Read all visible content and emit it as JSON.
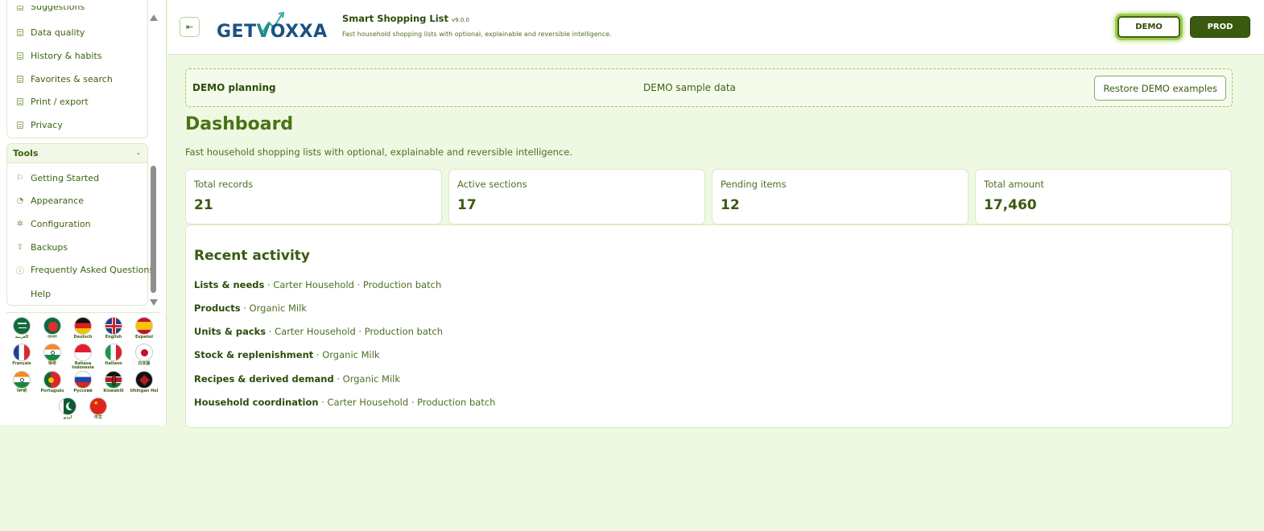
{
  "sidebar": {
    "top_items": [
      {
        "label": "Suggestions",
        "icon": "document-icon"
      },
      {
        "label": "Data quality",
        "icon": "document-icon"
      },
      {
        "label": "History & habits",
        "icon": "document-icon"
      },
      {
        "label": "Favorites & search",
        "icon": "document-icon"
      },
      {
        "label": "Print / export",
        "icon": "document-icon"
      },
      {
        "label": "Privacy",
        "icon": "document-icon"
      }
    ],
    "tools_title": "Tools",
    "tools_collapse": "-",
    "tools_items": [
      {
        "label": "Getting Started",
        "icon": "flag-icon"
      },
      {
        "label": "Appearance",
        "icon": "palette-icon"
      },
      {
        "label": "Configuration",
        "icon": "gear-icon"
      },
      {
        "label": "Backups",
        "icon": "upload-icon"
      },
      {
        "label": "Frequently Asked Questions",
        "icon": "question-icon"
      },
      {
        "label": "Help",
        "icon": ""
      }
    ],
    "languages": [
      {
        "label": "العربية",
        "code": "ar"
      },
      {
        "label": "বাংলা",
        "code": "bn"
      },
      {
        "label": "Deutsch",
        "code": "de"
      },
      {
        "label": "English",
        "code": "en"
      },
      {
        "label": "Español",
        "code": "es"
      },
      {
        "label": "Français",
        "code": "fr"
      },
      {
        "label": "हिन्दी",
        "code": "hi"
      },
      {
        "label": "Bahasa Indonesia",
        "code": "id"
      },
      {
        "label": "Italiano",
        "code": "it"
      },
      {
        "label": "日本語",
        "code": "ja"
      },
      {
        "label": "ਪੰਜਾਬੀ",
        "code": "pa"
      },
      {
        "label": "Português",
        "code": "pt"
      },
      {
        "label": "Русский",
        "code": "ru"
      },
      {
        "label": "Kiswahili",
        "code": "sw"
      },
      {
        "label": "tlhIngan Hol",
        "code": "tlh"
      },
      {
        "label": "اردو",
        "code": "ur"
      },
      {
        "label": "中文",
        "code": "zh"
      }
    ]
  },
  "header": {
    "logo_text_a": "GET",
    "logo_text_b": "V",
    "logo_text_c": "OXXA",
    "app_title": "Smart Shopping List",
    "version": "v9.0.0",
    "subtitle": "Fast household shopping lists with optional, explainable and reversible intelligence.",
    "env_demo": "DEMO",
    "env_prod": "PROD"
  },
  "banner": {
    "title": "DEMO planning",
    "center": "DEMO sample data",
    "restore": "Restore DEMO examples"
  },
  "dashboard": {
    "title": "Dashboard",
    "subtitle": "Fast household shopping lists with optional, explainable and reversible intelligence.",
    "stats": [
      {
        "label": "Total records",
        "value": "21"
      },
      {
        "label": "Active sections",
        "value": "17"
      },
      {
        "label": "Pending items",
        "value": "12"
      },
      {
        "label": "Total amount",
        "value": "17,460"
      }
    ]
  },
  "activity": {
    "title": "Recent activity",
    "rows": [
      {
        "section": "Lists & needs",
        "detail": " · Carter Household · Production batch"
      },
      {
        "section": "Products",
        "detail": " · Organic Milk"
      },
      {
        "section": "Units & packs",
        "detail": " · Carter Household · Production batch"
      },
      {
        "section": "Stock & replenishment",
        "detail": " · Organic Milk"
      },
      {
        "section": "Recipes & derived demand",
        "detail": " · Organic Milk"
      },
      {
        "section": "Household coordination",
        "detail": " · Carter Household · Production batch"
      }
    ]
  },
  "colors": {
    "accent": "#3a5a10",
    "background": "#eef8e2",
    "logo_blue": "#1b5282",
    "logo_teal": "#1d8a8c"
  }
}
